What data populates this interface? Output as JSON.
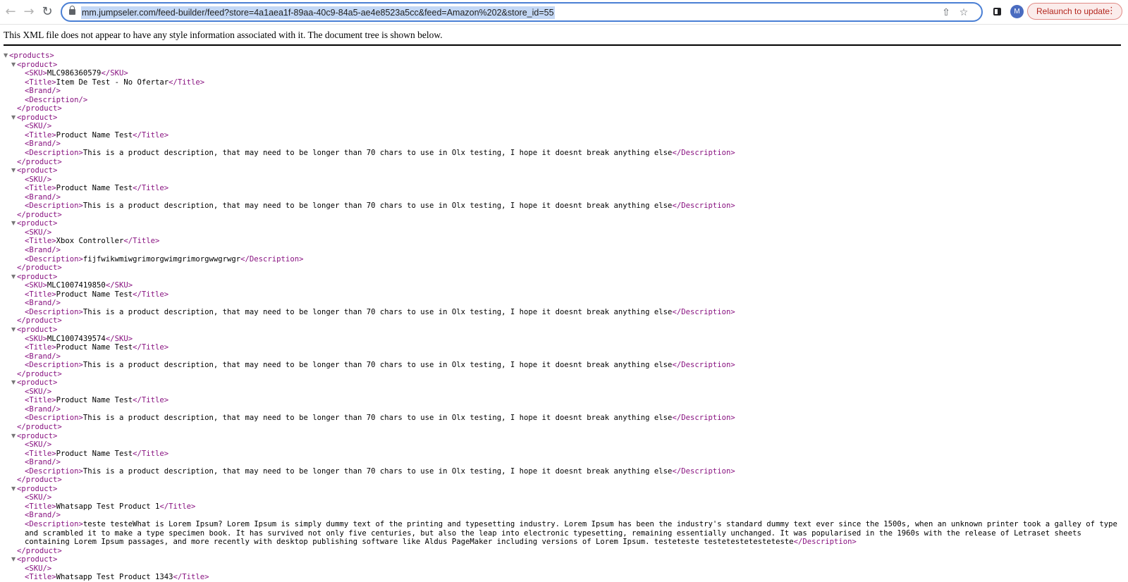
{
  "browser": {
    "url": "mm.jumpseler.com/feed-builder/feed?store=4a1aea1f-89aa-40c9-84a5-ae4e8523a5cc&feed=Amazon%202&store_id=55",
    "avatar_letter": "M",
    "relaunch_label": "Relaunch to update",
    "icons": [
      "back-icon",
      "forward-icon",
      "reload-icon",
      "lock-icon",
      "share-icon",
      "bookmark-star-icon",
      "side-panel-icon",
      "kebab-menu-icon"
    ]
  },
  "page": {
    "notice": "This XML file does not appear to have any style information associated with it. The document tree is shown below.",
    "root_open": "<products>",
    "product_open": "<product>",
    "product_close": "</product>",
    "products": [
      {
        "sku": "<SKU>MLC986360579</SKU>",
        "title": "<Title>Item De Test - No Ofertar</Title>",
        "brand": "<Brand/>",
        "description": "<Description/>"
      },
      {
        "sku": "<SKU/>",
        "title": "<Title>Product Name Test</Title>",
        "brand": "<Brand/>",
        "description": "<Description>This is a product description, that may need to be longer than 70 chars to use in Olx testing, I hope it doesnt break anything else</Description>"
      },
      {
        "sku": "<SKU/>",
        "title": "<Title>Product Name Test</Title>",
        "brand": "<Brand/>",
        "description": "<Description>This is a product description, that may need to be longer than 70 chars to use in Olx testing, I hope it doesnt break anything else</Description>"
      },
      {
        "sku": "<SKU/>",
        "title": "<Title>Xbox Controller</Title>",
        "brand": "<Brand/>",
        "description": "<Description>fijfwikwmiwgrimorgwimgrimorgwwgrwgr</Description>"
      },
      {
        "sku": "<SKU>MLC1007419850</SKU>",
        "title": "<Title>Product Name Test</Title>",
        "brand": "<Brand/>",
        "description": "<Description>This is a product description, that may need to be longer than 70 chars to use in Olx testing, I hope it doesnt break anything else</Description>"
      },
      {
        "sku": "<SKU>MLC1007439574</SKU>",
        "title": "<Title>Product Name Test</Title>",
        "brand": "<Brand/>",
        "description": "<Description>This is a product description, that may need to be longer than 70 chars to use in Olx testing, I hope it doesnt break anything else</Description>"
      },
      {
        "sku": "<SKU/>",
        "title": "<Title>Product Name Test</Title>",
        "brand": "<Brand/>",
        "description": "<Description>This is a product description, that may need to be longer than 70 chars to use in Olx testing, I hope it doesnt break anything else</Description>"
      },
      {
        "sku": "<SKU/>",
        "title": "<Title>Product Name Test</Title>",
        "brand": "<Brand/>",
        "description": "<Description>This is a product description, that may need to be longer than 70 chars to use in Olx testing, I hope it doesnt break anything else</Description>"
      },
      {
        "sku": "<SKU/>",
        "title": "<Title>Whatsapp Test Product 1</Title>",
        "brand": "<Brand/>",
        "description": "<Description>teste testeWhat is Lorem Ipsum? Lorem Ipsum is simply dummy text of the printing and typesetting industry. Lorem Ipsum has been the industry's standard dummy text ever since the 1500s, when an unknown printer took a galley of type and scrambled it to make a type specimen book. It has survived not only five centuries, but also the leap into electronic typesetting, remaining essentially unchanged. It was popularised in the 1960s with the release of Letraset sheets containing Lorem Ipsum passages, and more recently with desktop publishing software like Aldus PageMaker including versions of Lorem Ipsum. testeteste testetestetesteteste</Description>"
      },
      {
        "sku": "<SKU/>",
        "title": "<Title>Whatsapp Test Product 1343</Title>",
        "brand": "",
        "description": ""
      }
    ]
  }
}
